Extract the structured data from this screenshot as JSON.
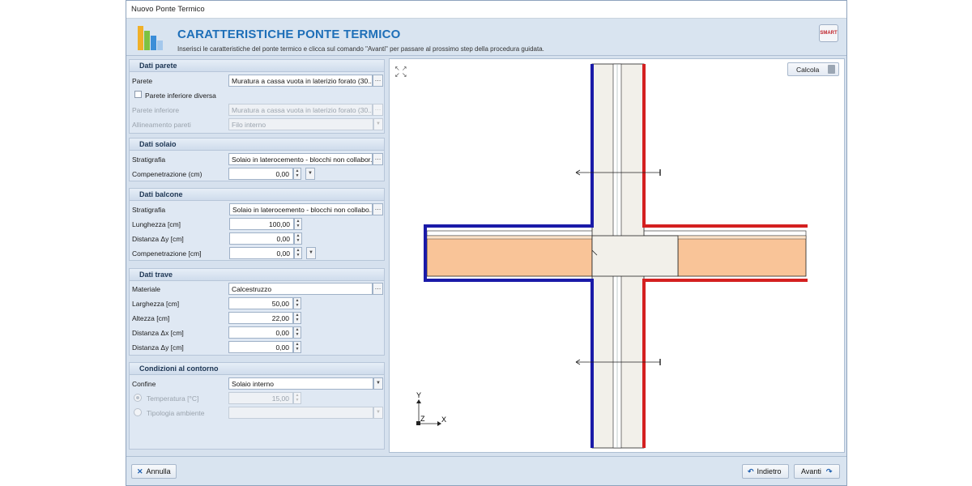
{
  "window": {
    "title": "Nuovo Ponte Termico"
  },
  "header": {
    "title": "CARATTERISTICHE PONTE TERMICO",
    "subtitle": "Inserisci le caratteristiche del ponte termico e clicca sul comando \"Avanti\" per passare al prossimo step della procedura guidata.",
    "badge": "SMART"
  },
  "parete": {
    "title": "Dati parete",
    "parete_label": "Parete",
    "parete_value": "Muratura a cassa vuota in laterizio forato (30...",
    "inferiore_diversa_label": "Parete inferiore diversa",
    "inferiore_label": "Parete inferiore",
    "inferiore_value": "Muratura a cassa vuota in laterizio forato (30...",
    "allineamento_label": "Allineamento pareti",
    "allineamento_value": "Filo interno"
  },
  "solaio": {
    "title": "Dati solaio",
    "stratigrafia_label": "Stratigrafia",
    "stratigrafia_value": "Solaio in laterocemento - blocchi non collabor...",
    "compenetrazione_label": "Compenetrazione (cm)",
    "compenetrazione_value": "0,00"
  },
  "balcone": {
    "title": "Dati balcone",
    "stratigrafia_label": "Stratigrafia",
    "stratigrafia_value": "Solaio in laterocemento - blocchi non collabo...",
    "lunghezza_label": "Lunghezza [cm]",
    "lunghezza_value": "100,00",
    "distanza_y_label": "Distanza Δy [cm]",
    "distanza_y_value": "0,00",
    "compenetrazione_label": "Compenetrazione [cm]",
    "compenetrazione_value": "0,00"
  },
  "trave": {
    "title": "Dati trave",
    "materiale_label": "Materiale",
    "materiale_value": "Calcestruzzo",
    "larghezza_label": "Larghezza [cm]",
    "larghezza_value": "50,00",
    "altezza_label": "Altezza [cm]",
    "altezza_value": "22,00",
    "distanza_x_label": "Distanza Δx [cm]",
    "distanza_x_value": "0,00",
    "distanza_y_label": "Distanza Δy [cm]",
    "distanza_y_value": "0,00"
  },
  "contorno": {
    "title": "Condizioni al contorno",
    "confine_label": "Confine",
    "confine_value": "Solaio interno",
    "temperatura_label": "Temperatura [°C]",
    "temperatura_value": "15,00",
    "tipologia_label": "Tipologia ambiente",
    "tipologia_value": ""
  },
  "canvas": {
    "calcola_label": "Calcola",
    "axis_y": "Y",
    "axis_z": "Z",
    "axis_x": "X"
  },
  "footer": {
    "annulla": "Annulla",
    "indietro": "Indietro",
    "avanti": "Avanti"
  },
  "colors": {
    "accent": "#1e6fb8",
    "cold_side": "#1a1aa8",
    "warm_side": "#d42020",
    "slab": "#f9c498",
    "wall": "#f2f0ea"
  }
}
